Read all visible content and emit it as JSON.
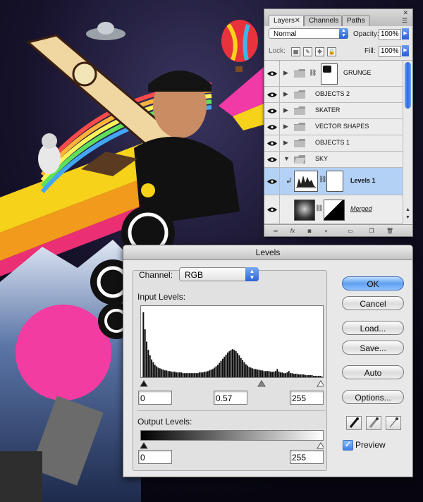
{
  "layers_panel": {
    "tabs": [
      {
        "label": "Layers",
        "close": "✕"
      },
      {
        "label": "Channels"
      },
      {
        "label": "Paths"
      }
    ],
    "panel_close": "✕",
    "blend_mode": "Normal",
    "opacity_label": "Opacity:",
    "opacity_value": "100%",
    "lock_label": "Lock:",
    "fill_label": "Fill:",
    "fill_value": "100%",
    "layers": [
      {
        "name": "GRUNGE",
        "type": "folder-with-mask"
      },
      {
        "name": "OBJECTS 2",
        "type": "folder"
      },
      {
        "name": "SKATER",
        "type": "folder"
      },
      {
        "name": "VECTOR SHAPES",
        "type": "folder"
      },
      {
        "name": "OBJECTS 1",
        "type": "folder"
      },
      {
        "name": "SKY",
        "type": "folder-open"
      },
      {
        "name": "Levels 1",
        "type": "adjustment",
        "selected": true
      },
      {
        "name": "Merged",
        "type": "layer-with-mask"
      }
    ],
    "bottom_icons": [
      "link-icon",
      "fx-icon",
      "mask-icon",
      "adjustment-icon",
      "group-icon",
      "new-layer-icon",
      "trash-icon"
    ],
    "fx_label": "fx"
  },
  "levels_dialog": {
    "title": "Levels",
    "channel_label": "Channel:",
    "channel_value": "RGB",
    "input_levels_label": "Input Levels:",
    "input_black": "0",
    "input_gamma": "0.57",
    "input_white": "255",
    "output_levels_label": "Output Levels:",
    "output_black": "0",
    "output_white": "255",
    "buttons": {
      "ok": "OK",
      "cancel": "Cancel",
      "load": "Load...",
      "save": "Save...",
      "auto": "Auto",
      "options": "Options..."
    },
    "preview_label": "Preview",
    "preview_checked": true,
    "histogram": [
      0,
      95,
      70,
      52,
      40,
      32,
      26,
      22,
      18,
      16,
      14,
      13,
      12,
      11,
      10,
      10,
      9,
      9,
      8,
      8,
      8,
      7,
      7,
      7,
      7,
      6,
      6,
      6,
      6,
      6,
      6,
      6,
      6,
      6,
      6,
      7,
      7,
      7,
      8,
      8,
      9,
      10,
      11,
      12,
      14,
      16,
      18,
      21,
      24,
      27,
      30,
      33,
      36,
      38,
      40,
      41,
      40,
      38,
      35,
      32,
      28,
      25,
      22,
      19,
      17,
      15,
      14,
      13,
      12,
      12,
      11,
      11,
      10,
      10,
      9,
      9,
      9,
      9,
      8,
      8,
      8,
      9,
      12,
      8,
      7,
      7,
      6,
      6,
      7,
      9,
      6,
      6,
      5,
      5,
      5,
      4,
      4,
      4,
      4,
      3,
      3,
      3,
      3,
      3,
      2,
      2,
      2,
      2,
      2,
      1
    ]
  }
}
